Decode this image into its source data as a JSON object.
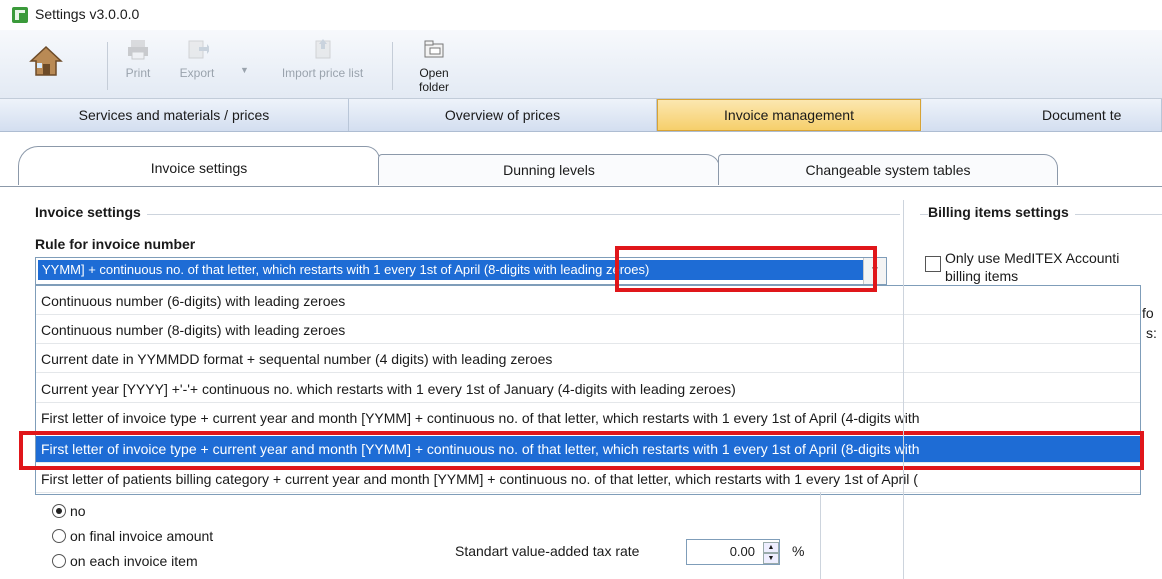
{
  "window": {
    "title": "Settings v3.0.0.0",
    "icon": "settings-app-icon"
  },
  "toolbar": {
    "home_icon": "home-icon",
    "print_label": "Print",
    "export_label": "Export",
    "import_label": "Import price list",
    "open_folder_label": "Open folder"
  },
  "main_tabs": [
    {
      "label": "Services and materials / prices",
      "active": false
    },
    {
      "label": "Overview of prices",
      "active": false
    },
    {
      "label": "Invoice management",
      "active": true
    },
    {
      "label": "Document te",
      "active": false
    }
  ],
  "sub_tabs": [
    {
      "label": "Invoice settings",
      "active": true
    },
    {
      "label": "Dunning levels",
      "active": false
    },
    {
      "label": "Changeable system tables",
      "active": false
    }
  ],
  "invoice_settings": {
    "group_title": "Invoice settings",
    "rule_label": "Rule for invoice number",
    "rule_value": "YYMM] + continuous no. of that letter, which restarts with 1 every 1st of April (8-digits with leading zeroes)",
    "options": [
      "Continuous number (6-digits) with leading zeroes",
      "Continuous number (8-digits) with leading zeroes",
      "Current date in YYMMDD format + sequental number (4 digits) with leading zeroes",
      "Current year [YYYY] +'-'+ continuous no. which restarts with 1 every 1st of January (4-digits with leading zeroes)",
      "First letter of invoice type + current year and month [YYMM] + continuous no. of that letter, which restarts with 1 every 1st of April (4-digits with",
      "First letter of invoice type + current year and month [YYMM] + continuous no. of that letter, which restarts with 1 every 1st of April (8-digits with",
      "First letter of patients billing category + current year and month [YYMM] + continuous no. of that letter, which restarts with 1 every 1st of April ("
    ],
    "selected_index": 5,
    "vat_options": [
      "no",
      "on final invoice amount",
      "on each invoice item"
    ],
    "vat_selected_index": 0,
    "vat_rate_label": "Standart value-added tax rate",
    "vat_rate_value": "0.00",
    "vat_unit": "%"
  },
  "billing_items": {
    "group_title": "Billing items settings",
    "checkbox_label_line1": "Only use MedITEX Accounti",
    "checkbox_label_line2": "billing items",
    "checked": false,
    "clipped_text_1": "fo",
    "clipped_text_2": "s:"
  },
  "colors": {
    "selection": "#1e6cd5",
    "highlight_box": "#e0161a",
    "active_tab": "#f6cf6b"
  }
}
